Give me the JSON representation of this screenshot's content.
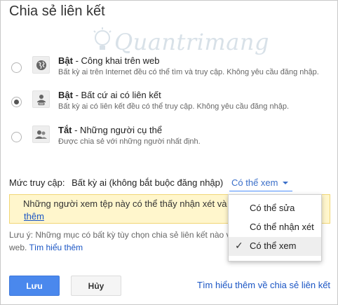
{
  "dialog": {
    "title": "Chia sẻ liên kết"
  },
  "watermark": {
    "text": "Quantrimang"
  },
  "options": [
    {
      "state": "Bật",
      "name": " - Công khai trên web",
      "desc": "Bất kỳ ai trên Internet đều có thể tìm và truy cập. Không yêu cầu đăng nhập.",
      "checked": false,
      "icon": "globe-icon"
    },
    {
      "state": "Bật",
      "name": " - Bất cứ ai có liên kết",
      "desc": "Bất kỳ ai có liên kết đều có thể truy cập. Không yêu cầu đăng nhập.",
      "checked": true,
      "icon": "person-link-icon"
    },
    {
      "state": "Tắt",
      "name": " - Những người cụ thể",
      "desc": "Được chia sẻ với những người nhất định.",
      "checked": false,
      "icon": "people-icon"
    }
  ],
  "access": {
    "label": "Mức truy cập:",
    "value": "Bất kỳ ai (không bắt buộc đăng nhập)",
    "dropdown": "Có thể xem"
  },
  "warning": {
    "text": "Những người xem tệp này có thể thấy nhận xét và",
    "more": "thêm"
  },
  "note": {
    "text": "Lưu ý: Những mục có bất kỳ tùy chọn chia sẻ liên kết nào về",
    "text2": "web.",
    "link": "Tìm hiểu thêm"
  },
  "menu": {
    "items": [
      {
        "label": "Có thể sửa",
        "selected": false
      },
      {
        "label": "Có thể nhận xét",
        "selected": false
      },
      {
        "label": "Có thể xem",
        "selected": true
      }
    ],
    "check": "✓"
  },
  "buttons": {
    "save": "Lưu",
    "cancel": "Hủy"
  },
  "learn_more": "Tìm hiểu thêm về chia sẻ liên kết",
  "colors": {
    "primary": "#4a88ed",
    "link": "#1a55c4",
    "warning_bg": "#fff6cc"
  }
}
